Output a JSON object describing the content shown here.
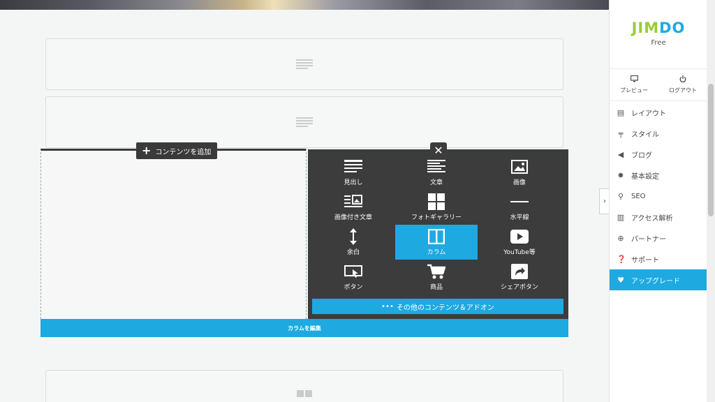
{
  "add_content": {
    "label": "コンテンツを追加"
  },
  "panel": {
    "items": [
      {
        "label": "見出し",
        "icon": "heading-icon"
      },
      {
        "label": "文章",
        "icon": "text-icon"
      },
      {
        "label": "画像",
        "icon": "image-icon"
      },
      {
        "label": "画像付き文章",
        "icon": "text-with-image-icon"
      },
      {
        "label": "フォトギャラリー",
        "icon": "photo-gallery-icon"
      },
      {
        "label": "水平線",
        "icon": "horizontal-line-icon"
      },
      {
        "label": "余白",
        "icon": "spacing-icon"
      },
      {
        "label": "カラム",
        "icon": "column-icon"
      },
      {
        "label": "YouTube等",
        "icon": "youtube-icon"
      },
      {
        "label": "ボタン",
        "icon": "button-icon"
      },
      {
        "label": "商品",
        "icon": "cart-icon"
      },
      {
        "label": "シェアボタン",
        "icon": "share-icon"
      }
    ],
    "active_item": "カラム",
    "more_label": "その他のコンテンツ＆アドオン"
  },
  "column_edit_bar": {
    "label": "カラムを編集"
  },
  "sidebar": {
    "logo": "JIMDO",
    "plan": "Free",
    "preview_label": "プレビュー",
    "logout_label": "ログアウト",
    "menu": [
      {
        "label": "レイアウト",
        "icon": "layout-icon"
      },
      {
        "label": "スタイル",
        "icon": "paint-roller-icon"
      },
      {
        "label": "ブログ",
        "icon": "megaphone-icon"
      },
      {
        "label": "基本設定",
        "icon": "gear-icon"
      },
      {
        "label": "SEO",
        "icon": "search-icon"
      },
      {
        "label": "アクセス解析",
        "icon": "bar-chart-icon"
      },
      {
        "label": "パートナー",
        "icon": "plus-circle-icon"
      },
      {
        "label": "サポート",
        "icon": "question-icon"
      },
      {
        "label": "アップグレード",
        "icon": "heart-icon"
      }
    ]
  },
  "colors": {
    "accent": "#1ea9e1",
    "panel_bg": "#3c3c3c",
    "logo_green": "#9acd32",
    "logo_blue": "#1ea9e1"
  }
}
